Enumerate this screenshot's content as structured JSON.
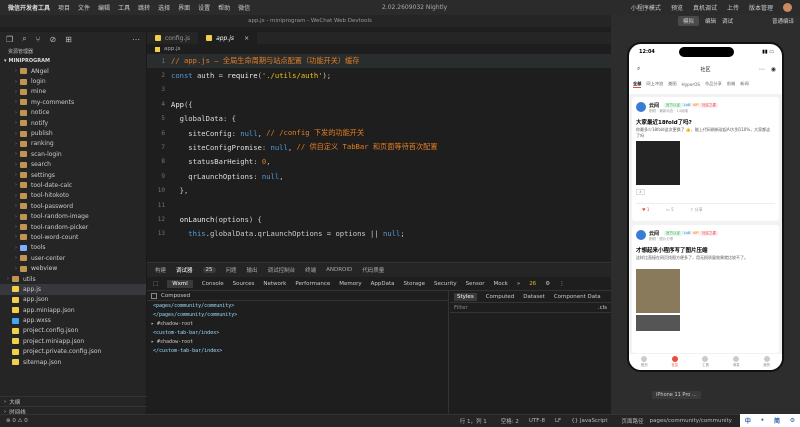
{
  "menubar": {
    "app_name": "微信开发者工具",
    "items": [
      "项目",
      "文件",
      "编辑",
      "工具",
      "跳转",
      "选择",
      "界面",
      "设置",
      "帮助",
      "微信"
    ],
    "version": "2.02.2609032 Nightly",
    "right_items": [
      "小程序模式",
      "预览",
      "真机调试",
      "上传",
      "版本管理"
    ]
  },
  "title": "app.js - miniprogram - WeChat Web Devtools",
  "explorer": {
    "header": "资源管理器",
    "project": "MINIPROGRAM",
    "tree": [
      {
        "label": "ANgel",
        "type": "folder",
        "indent": 1
      },
      {
        "label": "login",
        "type": "folder",
        "indent": 1
      },
      {
        "label": "mine",
        "type": "folder",
        "indent": 1
      },
      {
        "label": "my-comments",
        "type": "folder",
        "indent": 1
      },
      {
        "label": "notice",
        "type": "folder",
        "indent": 1
      },
      {
        "label": "notify",
        "type": "folder",
        "indent": 1
      },
      {
        "label": "publish",
        "type": "folder",
        "indent": 1
      },
      {
        "label": "ranking",
        "type": "folder",
        "indent": 1
      },
      {
        "label": "scan-login",
        "type": "folder",
        "indent": 1
      },
      {
        "label": "search",
        "type": "folder",
        "indent": 1
      },
      {
        "label": "settings",
        "type": "folder",
        "indent": 1
      },
      {
        "label": "tool-date-calc",
        "type": "folder",
        "indent": 1
      },
      {
        "label": "tool-hitokoto",
        "type": "folder",
        "indent": 1
      },
      {
        "label": "tool-password",
        "type": "folder",
        "indent": 1
      },
      {
        "label": "tool-random-image",
        "type": "folder",
        "indent": 1
      },
      {
        "label": "tool-random-picker",
        "type": "folder",
        "indent": 1
      },
      {
        "label": "tool-word-count",
        "type": "folder",
        "indent": 1
      },
      {
        "label": "tools",
        "type": "tools",
        "indent": 1
      },
      {
        "label": "user-center",
        "type": "folder",
        "indent": 1
      },
      {
        "label": "webview",
        "type": "folder",
        "indent": 1
      },
      {
        "label": "utils",
        "type": "folder",
        "indent": 0
      },
      {
        "label": "app.js",
        "type": "js",
        "indent": 0,
        "selected": true
      },
      {
        "label": "app.json",
        "type": "json",
        "indent": 0
      },
      {
        "label": "app.miniapp.json",
        "type": "json",
        "indent": 0
      },
      {
        "label": "app.wxss",
        "type": "wxss",
        "indent": 0
      },
      {
        "label": "project.config.json",
        "type": "json",
        "indent": 0
      },
      {
        "label": "project.miniapp.json",
        "type": "json",
        "indent": 0
      },
      {
        "label": "project.private.config.json",
        "type": "json",
        "indent": 0
      },
      {
        "label": "sitemap.json",
        "type": "json",
        "indent": 0
      }
    ],
    "outline": "大纲",
    "timeline": "时间线"
  },
  "editor": {
    "tabs": [
      {
        "label": "config.js",
        "active": false
      },
      {
        "label": "app.js",
        "active": true
      }
    ],
    "breadcrumb": "app.js",
    "lines": [
      {
        "n": "1",
        "segs": [
          {
            "c": "cm",
            "t": "// app.js — 全局生命周期与站点配置（功能开关）缓存"
          }
        ]
      },
      {
        "n": "2",
        "segs": [
          {
            "c": "kw",
            "t": "const "
          },
          {
            "c": "prop",
            "t": "auth"
          },
          {
            "c": "punc",
            "t": " = "
          },
          {
            "c": "fn",
            "t": "require"
          },
          {
            "c": "punc",
            "t": "("
          },
          {
            "c": "str",
            "t": "'./utils/auth'"
          },
          {
            "c": "punc",
            "t": ");"
          }
        ]
      },
      {
        "n": "3",
        "segs": []
      },
      {
        "n": "4",
        "segs": [
          {
            "c": "fn",
            "t": "App"
          },
          {
            "c": "punc",
            "t": "({"
          }
        ]
      },
      {
        "n": "5",
        "segs": [
          {
            "c": "prop",
            "t": "  globalData"
          },
          {
            "c": "punc",
            "t": ": {"
          }
        ]
      },
      {
        "n": "6",
        "segs": [
          {
            "c": "prop",
            "t": "    siteConfig"
          },
          {
            "c": "punc",
            "t": ": "
          },
          {
            "c": "kw",
            "t": "null"
          },
          {
            "c": "punc",
            "t": ", "
          },
          {
            "c": "cm",
            "t": "// /config 下发的功能开关"
          }
        ]
      },
      {
        "n": "7",
        "segs": [
          {
            "c": "prop",
            "t": "    siteConfigPromise"
          },
          {
            "c": "punc",
            "t": ": "
          },
          {
            "c": "kw",
            "t": "null"
          },
          {
            "c": "punc",
            "t": ", "
          },
          {
            "c": "cm",
            "t": "// 供自定义 TabBar 和页面等待首次配置"
          }
        ]
      },
      {
        "n": "8",
        "segs": [
          {
            "c": "prop",
            "t": "    statusBarHeight"
          },
          {
            "c": "punc",
            "t": ": "
          },
          {
            "c": "num",
            "t": "0"
          },
          {
            "c": "punc",
            "t": ","
          }
        ]
      },
      {
        "n": "9",
        "segs": [
          {
            "c": "prop",
            "t": "    qrLaunchOptions"
          },
          {
            "c": "punc",
            "t": ": "
          },
          {
            "c": "kw",
            "t": "null"
          },
          {
            "c": "punc",
            "t": ","
          }
        ]
      },
      {
        "n": "10",
        "segs": [
          {
            "c": "punc",
            "t": "  },"
          }
        ]
      },
      {
        "n": "11",
        "segs": []
      },
      {
        "n": "12",
        "segs": [
          {
            "c": "fn",
            "t": "  onLaunch"
          },
          {
            "c": "punc",
            "t": "("
          },
          {
            "c": "prop",
            "t": "options"
          },
          {
            "c": "punc",
            "t": ") {"
          }
        ]
      },
      {
        "n": "13",
        "segs": [
          {
            "c": "kw",
            "t": "    this"
          },
          {
            "c": "punc",
            "t": ".globalData.qrLaunchOptions = options || "
          },
          {
            "c": "kw",
            "t": "null"
          },
          {
            "c": "punc",
            "t": ";"
          }
        ]
      }
    ]
  },
  "panel": {
    "tabs": [
      "构建",
      "调试器",
      "问题",
      "输出",
      "调试控制台",
      "终端",
      "ANDROID",
      "代码质量"
    ],
    "active_tab": "调试器",
    "badge": "25",
    "devtools_tabs": [
      "Wxml",
      "Console",
      "Sources",
      "Network",
      "Performance",
      "Memory",
      "AppData",
      "Storage",
      "Security",
      "Sensor",
      "Mock",
      "»"
    ],
    "warn_count": "26",
    "composed": "Composed",
    "dom_lines": [
      {
        "t": "<pages/community/community>",
        "sr": false
      },
      {
        "t": "</pages/community/community>",
        "sr": false
      },
      {
        "t": "▸ #shadow-root",
        "sr": true
      },
      {
        "t": "<custom-tab-bar/index>",
        "sr": false
      },
      {
        "t": "▸ #shadow-root",
        "sr": true
      },
      {
        "t": "</custom-tab-bar/index>",
        "sr": false
      }
    ],
    "styles_tabs": [
      "Styles",
      "Computed",
      "Dataset",
      "Component Data"
    ],
    "filter": "Filter",
    "cls": ".cls"
  },
  "status": {
    "left": "⊗ 0 ⚠ 0",
    "pos": "行 1，列 1",
    "spaces": "空格: 2",
    "enc": "UTF-8",
    "eol": "LF",
    "lang": "{} JavaScript",
    "path_label": "页面路径",
    "path": "pages/community/community"
  },
  "simulator": {
    "top": [
      "模拟",
      "编辑",
      "调试"
    ],
    "mode": "普通编译",
    "time": "12:04",
    "nav_title": "社区",
    "feed_tabs": [
      "全部",
      "网上冲浪",
      "美图",
      "HyperOS",
      "作品分享",
      "前端",
      "新闻"
    ],
    "posts": [
      {
        "user": "云间",
        "tags": [
          "官方认证",
          "Lv8",
          "VIP",
          "社区之星"
        ],
        "meta": "刚刚 · 最新动态 · 14阅读",
        "title": "大家最近18fold了吗?",
        "body": "你最多少18fold这次更换了 👍，能上代码刷新说起Al大到110%，大家都这了吗",
        "ltext": "1",
        "ctext": "5",
        "stext": "分享"
      },
      {
        "user": "云间",
        "tags": [
          "官方认证",
          "Lv8",
          "VIP",
          "社区之星"
        ],
        "meta": "刚刚 · 图片分享",
        "title": "才想起来小程序写了图片压缩",
        "body": "这样比直接在网页找图方便多了，用无损质量效果就比较不了。"
      }
    ],
    "tabbar": [
      "首页",
      "社区",
      "工具",
      "消息",
      "我的"
    ],
    "device": "iPhone 11 Pro ..."
  },
  "ime": [
    "中",
    "•",
    "简",
    "⚙"
  ]
}
